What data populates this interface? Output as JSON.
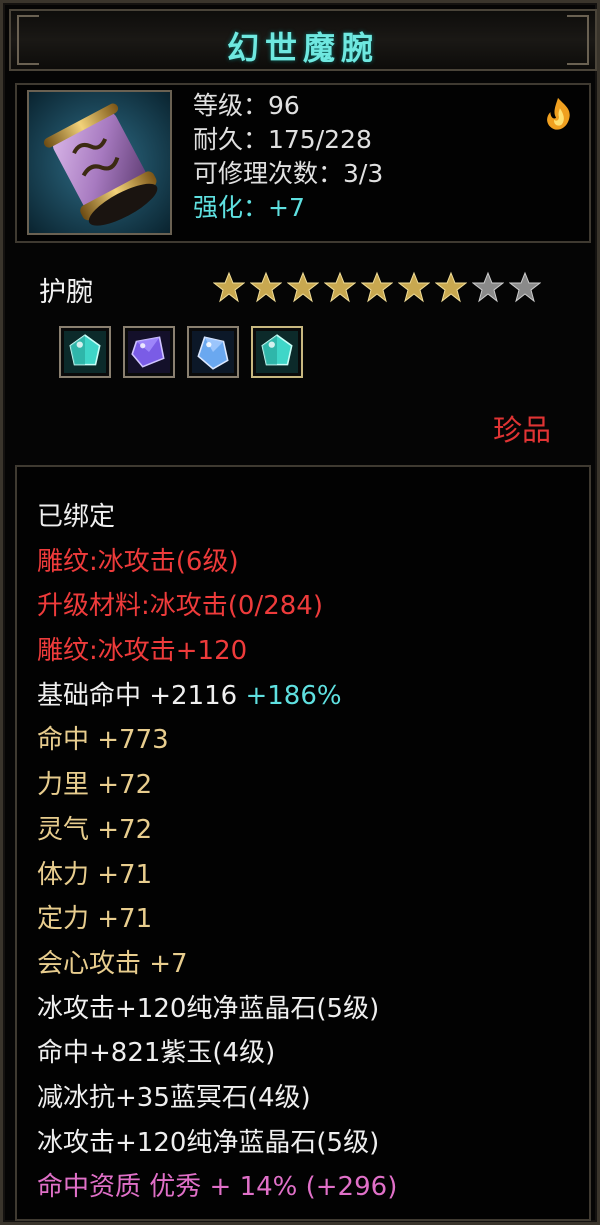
{
  "item": {
    "name": "幻世魔腕",
    "level_line": "等级：96",
    "durability_line": "耐久：175/228",
    "repair_line": "可修理次数：3/3",
    "enhance_line": "强化：+7",
    "type": "护腕",
    "rarity": "珍品"
  },
  "stars": {
    "filled": 7,
    "total": 9
  },
  "gems": [
    {
      "name": "cyan-gem-icon",
      "color": "#3fd6c8"
    },
    {
      "name": "purple-gem-icon",
      "color": "#7a5ce6"
    },
    {
      "name": "blue-gem-icon",
      "color": "#6aa8f0"
    },
    {
      "name": "cyan-gem-icon",
      "color": "#3fd6c8"
    }
  ],
  "description": {
    "bound": "已绑定",
    "engrave": "雕纹:冰攻击(6级)",
    "upgrade_material": "升级材料:冰攻击(0/284)",
    "engrave_bonus": "雕纹:冰攻击+120",
    "base_hit_label": "基础命中 +2116",
    "base_hit_pct": "+186%",
    "hit": "命中 +773",
    "strength": "力里 +72",
    "spirit": "灵气 +72",
    "stamina": "体力 +71",
    "focus": "定力 +71",
    "crit": "会心攻击 +7",
    "gem1": "冰攻击+120纯净蓝晶石(5级)",
    "gem2": "命中+821紫玉(4级)",
    "gem3": "减冰抗+35蓝冥石(4级)",
    "gem4": "冰攻击+120纯净蓝晶石(5级)",
    "quality": "命中资质 优秀 + 14% (+296)"
  },
  "colors": {
    "title": "#6fe8e0",
    "rarity": "#e03434",
    "red_text": "#ee3b3b",
    "gold_text": "#e8cd8e",
    "pink_text": "#e070c8",
    "cyan_text": "#5fe0e0"
  }
}
